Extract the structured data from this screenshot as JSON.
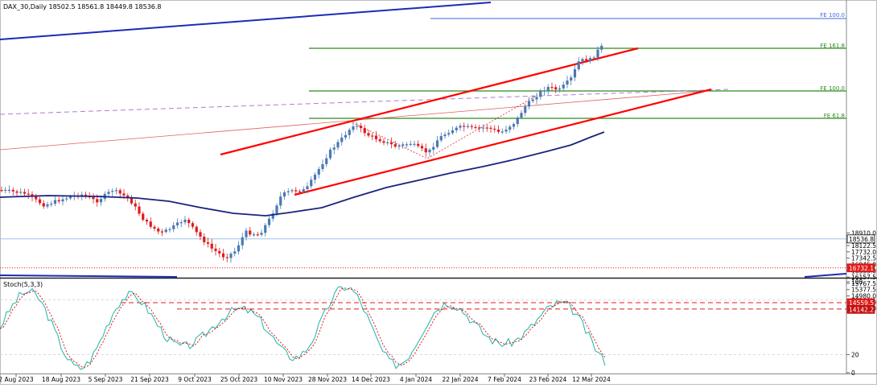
{
  "chart_data": {
    "type": "line",
    "symbol": "DAX_30",
    "timeframe": "Daily",
    "ohlc": {
      "open": "18502.5",
      "high": "18561.8",
      "low": "18449.8",
      "close": "18536.8"
    },
    "y_tick_labels": [
      "18910.0",
      "18122.5",
      "17732.0",
      "17342.5",
      "16945.0",
      "16555.0",
      "16157.5",
      "15767.5",
      "15377.5",
      "14980.0",
      "14590.0",
      "14200.0"
    ],
    "x_tick_labels": [
      "2 Aug 2023",
      "18 Aug 2023",
      "5 Sep 2023",
      "21 Sep 2023",
      "9 Oct 2023",
      "25 Oct 2023",
      "10 Nov 2023",
      "28 Nov 2023",
      "14 Dec 2023",
      "4 Jan 2024",
      "22 Jan 2024",
      "7 Feb 2024",
      "23 Feb 2024",
      "12 Mar 2024"
    ],
    "ylim": [
      14020,
      19400
    ],
    "price_tags": [
      {
        "text": "18536.8",
        "style": "current"
      },
      {
        "text": "16732.1",
        "style": "red"
      },
      {
        "text": "14559.5",
        "style": "red"
      },
      {
        "text": "14142.2",
        "style": "red-dark"
      }
    ],
    "fib_labels": [
      "FE 100.0",
      "FE 161.8",
      "FE 100.0",
      "FE 61.8"
    ],
    "stoch": {
      "label": "Stoch(5,3,3)",
      "ticks": [
        "100",
        "80",
        "20",
        "0"
      ]
    },
    "colors": {
      "up": "#4a79b3",
      "down": "#e01b1b",
      "ma": "#1a237e",
      "channel": "#ff0000",
      "fib": "#2e8b1f",
      "fe_top": "#4169e1",
      "stoch_k": "#20b2aa",
      "stoch_d": "#e01b1b"
    }
  }
}
